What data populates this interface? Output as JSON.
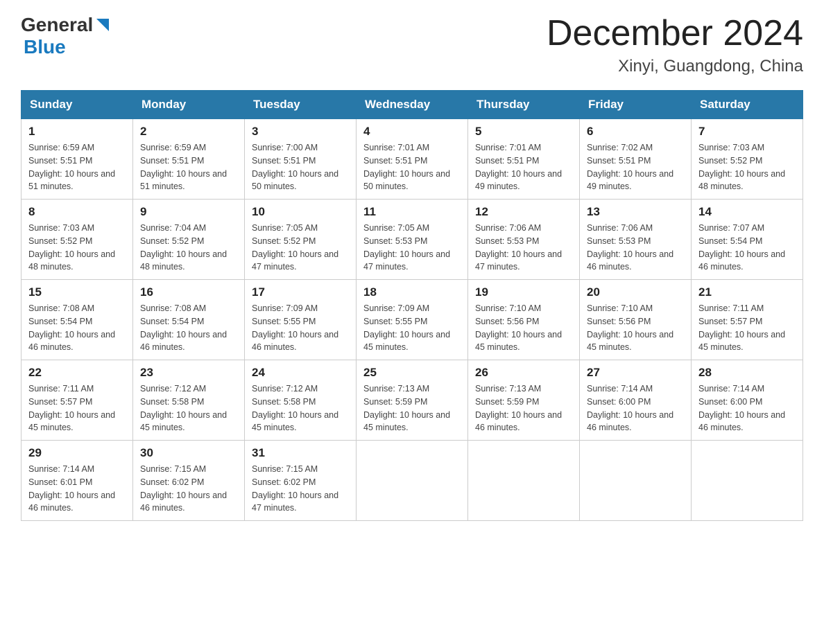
{
  "header": {
    "logo_general": "General",
    "logo_blue": "Blue",
    "month_title": "December 2024",
    "location": "Xinyi, Guangdong, China"
  },
  "days_of_week": [
    "Sunday",
    "Monday",
    "Tuesday",
    "Wednesday",
    "Thursday",
    "Friday",
    "Saturday"
  ],
  "weeks": [
    [
      {
        "day": "1",
        "sunrise": "6:59 AM",
        "sunset": "5:51 PM",
        "daylight": "10 hours and 51 minutes."
      },
      {
        "day": "2",
        "sunrise": "6:59 AM",
        "sunset": "5:51 PM",
        "daylight": "10 hours and 51 minutes."
      },
      {
        "day": "3",
        "sunrise": "7:00 AM",
        "sunset": "5:51 PM",
        "daylight": "10 hours and 50 minutes."
      },
      {
        "day": "4",
        "sunrise": "7:01 AM",
        "sunset": "5:51 PM",
        "daylight": "10 hours and 50 minutes."
      },
      {
        "day": "5",
        "sunrise": "7:01 AM",
        "sunset": "5:51 PM",
        "daylight": "10 hours and 49 minutes."
      },
      {
        "day": "6",
        "sunrise": "7:02 AM",
        "sunset": "5:51 PM",
        "daylight": "10 hours and 49 minutes."
      },
      {
        "day": "7",
        "sunrise": "7:03 AM",
        "sunset": "5:52 PM",
        "daylight": "10 hours and 48 minutes."
      }
    ],
    [
      {
        "day": "8",
        "sunrise": "7:03 AM",
        "sunset": "5:52 PM",
        "daylight": "10 hours and 48 minutes."
      },
      {
        "day": "9",
        "sunrise": "7:04 AM",
        "sunset": "5:52 PM",
        "daylight": "10 hours and 48 minutes."
      },
      {
        "day": "10",
        "sunrise": "7:05 AM",
        "sunset": "5:52 PM",
        "daylight": "10 hours and 47 minutes."
      },
      {
        "day": "11",
        "sunrise": "7:05 AM",
        "sunset": "5:53 PM",
        "daylight": "10 hours and 47 minutes."
      },
      {
        "day": "12",
        "sunrise": "7:06 AM",
        "sunset": "5:53 PM",
        "daylight": "10 hours and 47 minutes."
      },
      {
        "day": "13",
        "sunrise": "7:06 AM",
        "sunset": "5:53 PM",
        "daylight": "10 hours and 46 minutes."
      },
      {
        "day": "14",
        "sunrise": "7:07 AM",
        "sunset": "5:54 PM",
        "daylight": "10 hours and 46 minutes."
      }
    ],
    [
      {
        "day": "15",
        "sunrise": "7:08 AM",
        "sunset": "5:54 PM",
        "daylight": "10 hours and 46 minutes."
      },
      {
        "day": "16",
        "sunrise": "7:08 AM",
        "sunset": "5:54 PM",
        "daylight": "10 hours and 46 minutes."
      },
      {
        "day": "17",
        "sunrise": "7:09 AM",
        "sunset": "5:55 PM",
        "daylight": "10 hours and 46 minutes."
      },
      {
        "day": "18",
        "sunrise": "7:09 AM",
        "sunset": "5:55 PM",
        "daylight": "10 hours and 45 minutes."
      },
      {
        "day": "19",
        "sunrise": "7:10 AM",
        "sunset": "5:56 PM",
        "daylight": "10 hours and 45 minutes."
      },
      {
        "day": "20",
        "sunrise": "7:10 AM",
        "sunset": "5:56 PM",
        "daylight": "10 hours and 45 minutes."
      },
      {
        "day": "21",
        "sunrise": "7:11 AM",
        "sunset": "5:57 PM",
        "daylight": "10 hours and 45 minutes."
      }
    ],
    [
      {
        "day": "22",
        "sunrise": "7:11 AM",
        "sunset": "5:57 PM",
        "daylight": "10 hours and 45 minutes."
      },
      {
        "day": "23",
        "sunrise": "7:12 AM",
        "sunset": "5:58 PM",
        "daylight": "10 hours and 45 minutes."
      },
      {
        "day": "24",
        "sunrise": "7:12 AM",
        "sunset": "5:58 PM",
        "daylight": "10 hours and 45 minutes."
      },
      {
        "day": "25",
        "sunrise": "7:13 AM",
        "sunset": "5:59 PM",
        "daylight": "10 hours and 45 minutes."
      },
      {
        "day": "26",
        "sunrise": "7:13 AM",
        "sunset": "5:59 PM",
        "daylight": "10 hours and 46 minutes."
      },
      {
        "day": "27",
        "sunrise": "7:14 AM",
        "sunset": "6:00 PM",
        "daylight": "10 hours and 46 minutes."
      },
      {
        "day": "28",
        "sunrise": "7:14 AM",
        "sunset": "6:00 PM",
        "daylight": "10 hours and 46 minutes."
      }
    ],
    [
      {
        "day": "29",
        "sunrise": "7:14 AM",
        "sunset": "6:01 PM",
        "daylight": "10 hours and 46 minutes."
      },
      {
        "day": "30",
        "sunrise": "7:15 AM",
        "sunset": "6:02 PM",
        "daylight": "10 hours and 46 minutes."
      },
      {
        "day": "31",
        "sunrise": "7:15 AM",
        "sunset": "6:02 PM",
        "daylight": "10 hours and 47 minutes."
      },
      null,
      null,
      null,
      null
    ]
  ],
  "labels": {
    "sunrise_prefix": "Sunrise: ",
    "sunset_prefix": "Sunset: ",
    "daylight_prefix": "Daylight: "
  }
}
